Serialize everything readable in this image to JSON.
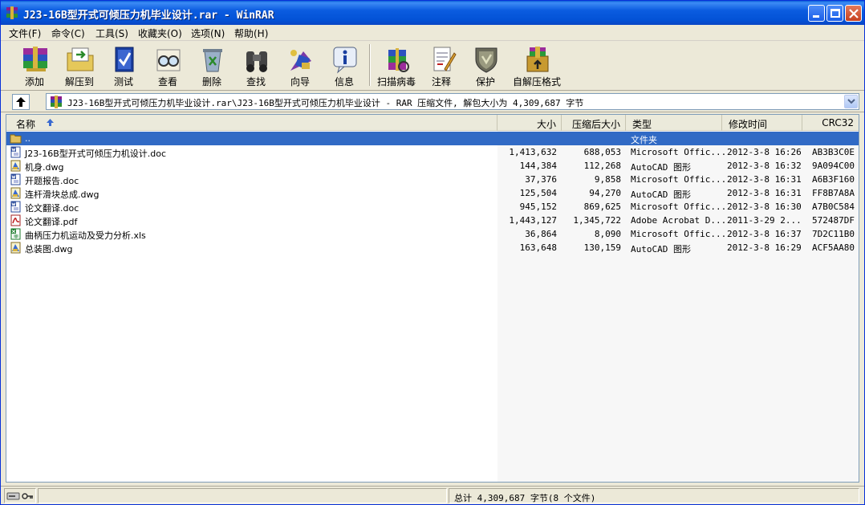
{
  "window": {
    "title": "J23-16B型开式可倾压力机毕业设计.rar - WinRAR"
  },
  "menu": [
    {
      "label": "文件(F)"
    },
    {
      "label": "命令(C)"
    },
    {
      "label": "工具(S)"
    },
    {
      "label": "收藏夹(O)"
    },
    {
      "label": "选项(N)"
    },
    {
      "label": "帮助(H)"
    }
  ],
  "toolbar": [
    {
      "label": "添加",
      "icon": "books-add-icon"
    },
    {
      "label": "解压到",
      "icon": "extract-folder-icon"
    },
    {
      "label": "测试",
      "icon": "test-check-icon"
    },
    {
      "label": "查看",
      "icon": "view-glasses-icon"
    },
    {
      "label": "删除",
      "icon": "delete-recycle-icon"
    },
    {
      "label": "查找",
      "icon": "find-binoculars-icon"
    },
    {
      "label": "向导",
      "icon": "wizard-icon"
    },
    {
      "label": "信息",
      "icon": "info-icon"
    },
    {
      "label": "扫描病毒",
      "icon": "virus-scan-icon"
    },
    {
      "label": "注释",
      "icon": "comment-icon"
    },
    {
      "label": "保护",
      "icon": "shield-icon"
    },
    {
      "label": "自解压格式",
      "icon": "sfx-box-icon"
    }
  ],
  "address": {
    "path": "J23-16B型开式可倾压力机毕业设计.rar\\J23-16B型开式可倾压力机毕业设计 - RAR 压缩文件, 解包大小为 4,309,687 字节"
  },
  "columns": {
    "name": "名称",
    "size": "大小",
    "packed": "压缩后大小",
    "type": "类型",
    "modified": "修改时间",
    "crc": "CRC32"
  },
  "parent_row": {
    "name": "..",
    "type": "文件夹"
  },
  "files": [
    {
      "name": "J23-16B型开式可倾压力机设计.doc",
      "size": "1,413,632",
      "packed": "688,053",
      "type": "Microsoft Offic...",
      "modified": "2012-3-8 16:26",
      "crc": "AB3B3C0E",
      "icon": "word-doc-icon"
    },
    {
      "name": "机身.dwg",
      "size": "144,384",
      "packed": "112,268",
      "type": "AutoCAD 图形",
      "modified": "2012-3-8 16:32",
      "crc": "9A094C00",
      "icon": "autocad-dwg-icon"
    },
    {
      "name": "开题报告.doc",
      "size": "37,376",
      "packed": "9,858",
      "type": "Microsoft Offic...",
      "modified": "2012-3-8 16:31",
      "crc": "A6B3F160",
      "icon": "word-doc-icon"
    },
    {
      "name": "连杆滑块总成.dwg",
      "size": "125,504",
      "packed": "94,270",
      "type": "AutoCAD 图形",
      "modified": "2012-3-8 16:31",
      "crc": "FF8B7A8A",
      "icon": "autocad-dwg-icon"
    },
    {
      "name": "论文翻译.doc",
      "size": "945,152",
      "packed": "869,625",
      "type": "Microsoft Offic...",
      "modified": "2012-3-8 16:30",
      "crc": "A7B0C584",
      "icon": "word-doc-icon"
    },
    {
      "name": "论文翻译.pdf",
      "size": "1,443,127",
      "packed": "1,345,722",
      "type": "Adobe Acrobat D...",
      "modified": "2011-3-29 2...",
      "crc": "572487DF",
      "icon": "pdf-icon"
    },
    {
      "name": "曲柄压力机运动及受力分析.xls",
      "size": "36,864",
      "packed": "8,090",
      "type": "Microsoft Offic...",
      "modified": "2012-3-8 16:37",
      "crc": "7D2C11B0",
      "icon": "excel-xls-icon"
    },
    {
      "name": "总装图.dwg",
      "size": "163,648",
      "packed": "130,159",
      "type": "AutoCAD 图形",
      "modified": "2012-3-8 16:29",
      "crc": "ACF5AA80",
      "icon": "autocad-dwg-icon"
    }
  ],
  "status": {
    "total": "总计 4,309,687 字节(8 个文件)"
  }
}
